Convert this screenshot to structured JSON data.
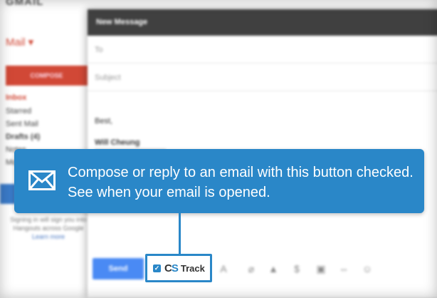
{
  "gmail": {
    "logo": "GMAIL",
    "mail_label": "Mail ▾",
    "compose_label": "COMPOSE",
    "folders": [
      "Inbox",
      "Starred",
      "Sent Mail",
      "Drafts (4)",
      "Notes",
      "More"
    ],
    "hangouts_text": "Signing in will sign you into Hangouts across Google",
    "learn_more": "Learn more"
  },
  "compose": {
    "title": "New Message",
    "to_placeholder": "To",
    "subject_placeholder": "Subject",
    "body_line": "Best,",
    "signature_name": "Will Cheung",
    "send_label": "Send",
    "toolbar_icons": [
      "formatting-icon",
      "attach-icon",
      "drive-icon",
      "money-icon",
      "photo-icon",
      "link-icon",
      "emoji-icon"
    ]
  },
  "callout": {
    "message": "Compose or reply to an email with this button checked. See when your email is opened.",
    "icon": "envelope-icon",
    "color": "#2a87c8"
  },
  "cs_track": {
    "checked": true,
    "logo_c": "C",
    "logo_s": "S",
    "label": "Track"
  }
}
